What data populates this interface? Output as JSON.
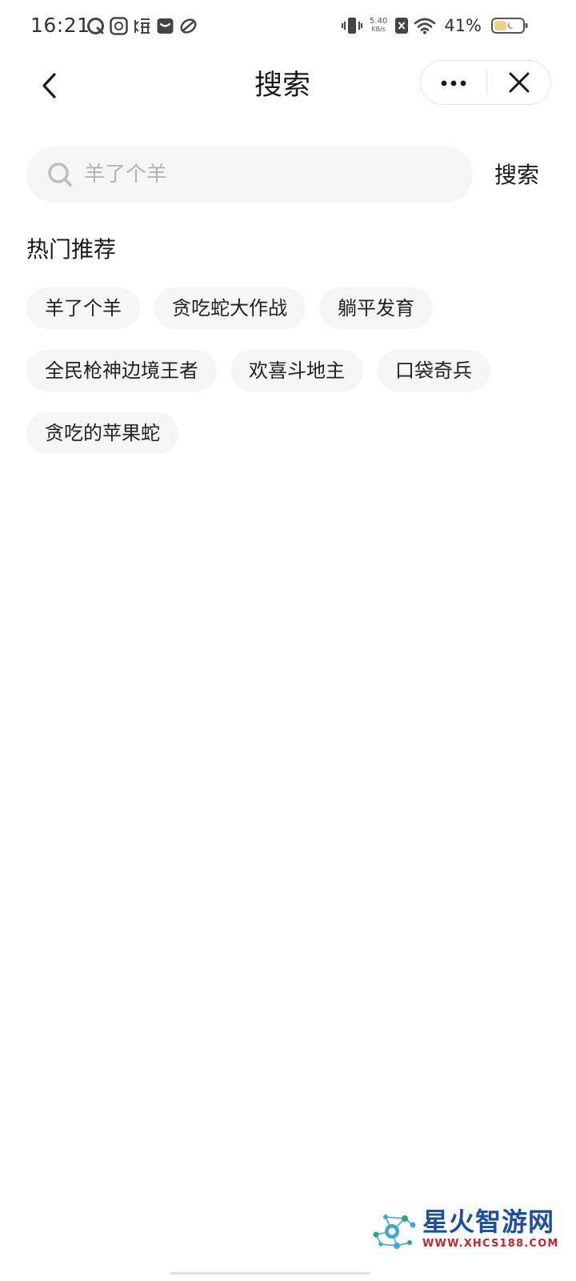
{
  "status_bar": {
    "time": "16:21",
    "network_speed_value": "5.40",
    "network_speed_unit": "KB/s",
    "battery_percent": "41%",
    "notification_icons": [
      "qq-icon",
      "app-du-icon",
      "bao-icon",
      "mail-icon",
      "app-swirl-icon"
    ],
    "system_icons": [
      "vibrate-icon",
      "no-sim-icon",
      "wifi-icon",
      "battery-icon"
    ]
  },
  "nav": {
    "title": "搜索",
    "back_icon": "chevron-left-icon",
    "more_icon": "more-dots-icon",
    "close_icon": "close-icon"
  },
  "search": {
    "placeholder": "羊了个羊",
    "value": "",
    "submit_label": "搜索",
    "icon": "search-icon"
  },
  "hot": {
    "title": "热门推荐",
    "tags": [
      "羊了个羊",
      "贪吃蛇大作战",
      "躺平发育",
      "全民枪神边境王者",
      "欢喜斗地主",
      "口袋奇兵",
      "贪吃的苹果蛇"
    ]
  },
  "watermark": {
    "name": "星火智游网",
    "url": "WWW.XHCS188.COM"
  },
  "colors": {
    "background": "#ffffff",
    "search_bg": "#f4f5f7",
    "tag_bg": "#f4f5f7",
    "text": "#1a1a1a",
    "placeholder": "#b3b3b3",
    "watermark_blue": "#1e4f9c",
    "watermark_red": "#c2262f"
  }
}
